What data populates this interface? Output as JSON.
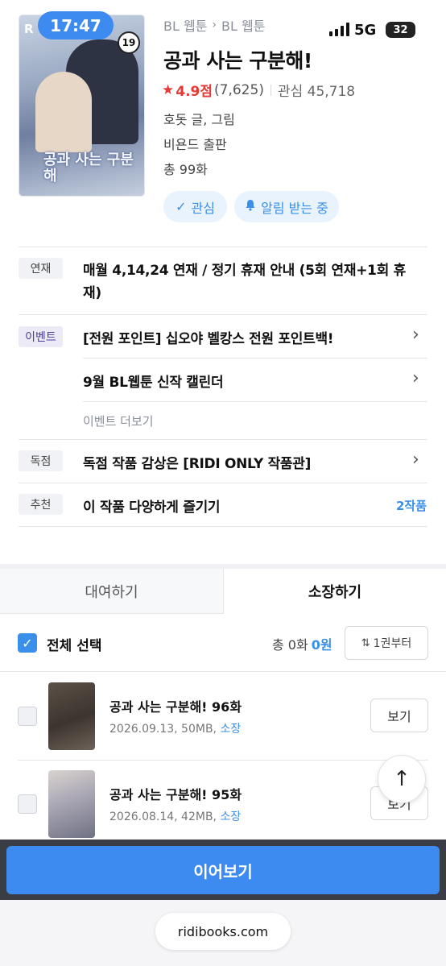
{
  "status_bar": {
    "time": "17:47",
    "network": "5G",
    "battery": "32"
  },
  "cover": {
    "logo": "R",
    "age_rating": "19",
    "cover_title": "공과 사는 구분해"
  },
  "header": {
    "breadcrumb": [
      "BL 웹툰",
      "BL 웹툰"
    ],
    "title": "공과 사는 구분해!",
    "rating": "4.9점",
    "rating_count": "(7,625)",
    "favorites": "관심 45,718",
    "author": "호돗 글, 그림",
    "publisher": "비욘드 출판",
    "total_episodes": "총 99화",
    "interest_button": "관심",
    "notification_button": "알림 받는 중"
  },
  "info_rows": {
    "serial_tag": "연재",
    "serial_text_line1": "매월 4,14,24 연재 / 정기 휴재 안내 (5회 연재+1회 휴",
    "serial_text_line2": "재)",
    "event_tag": "이벤트",
    "event1": "[전원 포인트] 십오야 벨캉스 전원 포인트백!",
    "event2": "9월 BL웹툰 신작 캘린더",
    "event_more": "이벤트 더보기",
    "exclusive_tag": "독점",
    "exclusive_text": "독점 작품 감상은 [RIDI ONLY 작품관]",
    "recommend_tag": "추천",
    "recommend_text": "이 작품 다양하게 즐기기",
    "recommend_count": "2작품"
  },
  "tabs": {
    "rent": "대여하기",
    "own": "소장하기"
  },
  "list_controls": {
    "select_all": "전체 선택",
    "total_label": "총 0화",
    "total_price": "0원",
    "sort_label": "1권부터"
  },
  "episodes": [
    {
      "title": "공과 사는 구분해! 96화",
      "meta": "2026.09.13, 50MB,",
      "status": "소장",
      "button": "보기"
    },
    {
      "title": "공과 사는 구분해! 95화",
      "meta": "2026.08.14, 42MB,",
      "status": "소장",
      "button": "보기"
    }
  ],
  "continue_button": "이어보기",
  "browser": {
    "url": "ridibooks.com"
  },
  "colors": {
    "accent_blue": "#3d8af0",
    "rating_red": "#e53935"
  }
}
